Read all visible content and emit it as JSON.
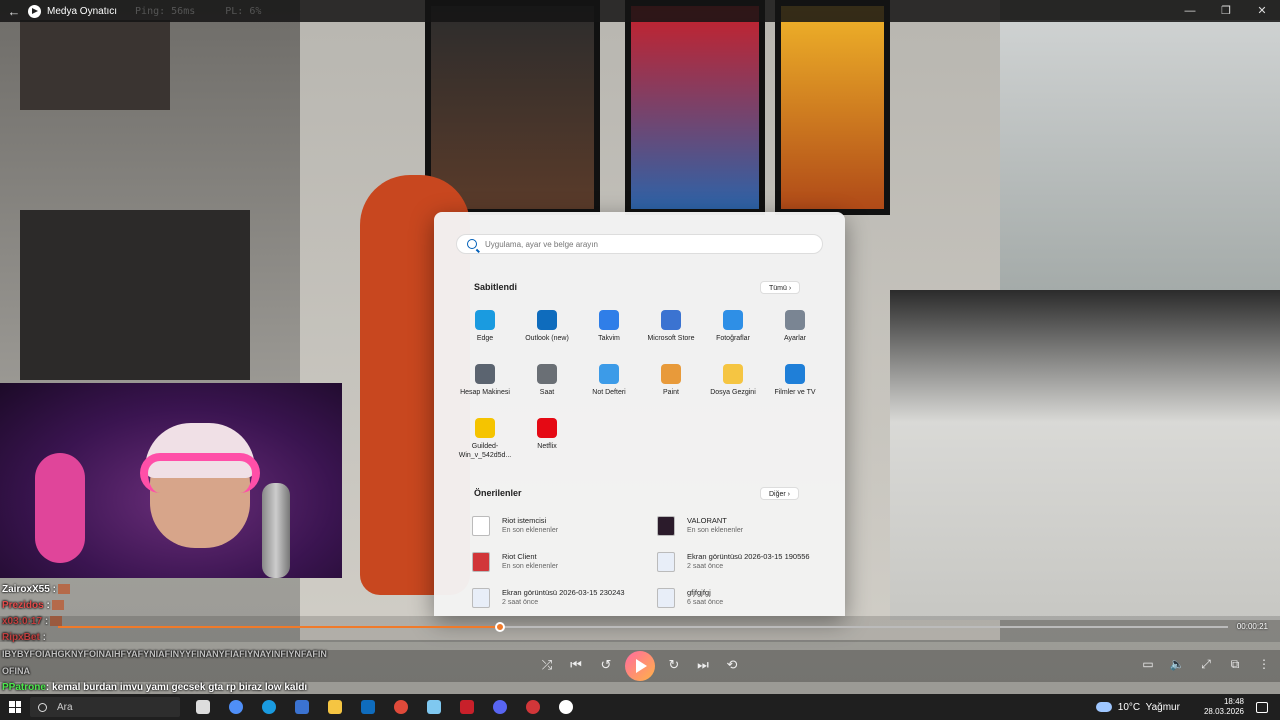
{
  "window": {
    "title": "Medya Oynatıcı",
    "ping": "Ping: 56ms",
    "pl": "PL: 6%",
    "controls": [
      "—",
      "❐",
      "✕"
    ]
  },
  "start_menu": {
    "search_placeholder": "Uygulama, ayar ve belge arayın",
    "pinned_title": "Sabitlendi",
    "all_label": "Tümü  ›",
    "pinned": [
      {
        "label": "Edge",
        "icon": "edge-icon",
        "color": "#1a9be0"
      },
      {
        "label": "Outlook (new)",
        "icon": "outlook-icon",
        "color": "#0f6cbd"
      },
      {
        "label": "Takvim",
        "icon": "calendar-icon",
        "color": "#2f7ee8"
      },
      {
        "label": "Microsoft Store",
        "icon": "store-icon",
        "color": "#3b73d1"
      },
      {
        "label": "Fotoğraflar",
        "icon": "photos-icon",
        "color": "#2e8fe6"
      },
      {
        "label": "Ayarlar",
        "icon": "gear-icon",
        "color": "#7a8593"
      },
      {
        "label": "Hesap Makinesi",
        "icon": "calculator-icon",
        "color": "#5b6470"
      },
      {
        "label": "Saat",
        "icon": "clock-icon",
        "color": "#6a6f75"
      },
      {
        "label": "Not Defteri",
        "icon": "notepad-icon",
        "color": "#3c9be8"
      },
      {
        "label": "Paint",
        "icon": "paint-icon",
        "color": "#e89a3a"
      },
      {
        "label": "Dosya Gezgini",
        "icon": "folder-icon",
        "color": "#f5c542"
      },
      {
        "label": "Filmler ve TV",
        "icon": "movies-icon",
        "color": "#1f7fd8"
      },
      {
        "label": "Guilded-Win_v_542d5d...",
        "icon": "guilded-icon",
        "color": "#f5c400"
      },
      {
        "label": "Netflix",
        "icon": "netflix-icon",
        "color": "#e50914"
      }
    ],
    "recommended_title": "Önerilenler",
    "more_label": "Diğer  ›",
    "recommended": [
      {
        "title": "Riot istemcisi",
        "sub": "En son eklenenler",
        "icon": "file-icon",
        "color": "#ffffff"
      },
      {
        "title": "VALORANT",
        "sub": "En son eklenenler",
        "icon": "valorant-icon",
        "color": "#2b1b2b"
      },
      {
        "title": "Riot Client",
        "sub": "En son eklenenler",
        "icon": "riot-icon",
        "color": "#d13639"
      },
      {
        "title": "Ekran görüntüsü 2026-03-15 190556",
        "sub": "2 saat önce",
        "icon": "image-file-icon",
        "color": "#e8eef8"
      },
      {
        "title": "Ekran görüntüsü 2026-03-15 230243",
        "sub": "2 saat önce",
        "icon": "image-file-icon",
        "color": "#e8eef8"
      },
      {
        "title": "gfjfgjfgj",
        "sub": "6 saat önce",
        "icon": "image-file-icon",
        "color": "#e8eef8"
      }
    ]
  },
  "chat": [
    {
      "user": "ZairoxX55",
      "text": ":",
      "color": "#ffffff"
    },
    {
      "user": "Prezidos",
      "text": ":",
      "color": "#e34b4b"
    },
    {
      "user": "x03:0:17",
      "text": ":",
      "color": "#e34b4b"
    },
    {
      "user": "RipxBet",
      "text": ":",
      "color": "#e34b4b"
    },
    {
      "user": "",
      "text": "IBYBYFOIAHGKNYFOINAIHFYAFYNIAFINYYFINANYFIAFIYNAYINFIYNFAFIN OFINA",
      "color": "#ffffff"
    },
    {
      "user": "PPatrone",
      "text": ": kemal burdan imvu yamı gecsek gta rp biraz low kaldı",
      "color": "#4de84d"
    }
  ],
  "player": {
    "time_current": "",
    "time_total": "00:00:21",
    "progress": 0.378
  },
  "taskbar": {
    "search_label": "Ara",
    "weather_temp": "10°C",
    "weather_desc": "Yağmur",
    "time": "18:48",
    "date": "28.03.2026",
    "notification_count": "2"
  }
}
